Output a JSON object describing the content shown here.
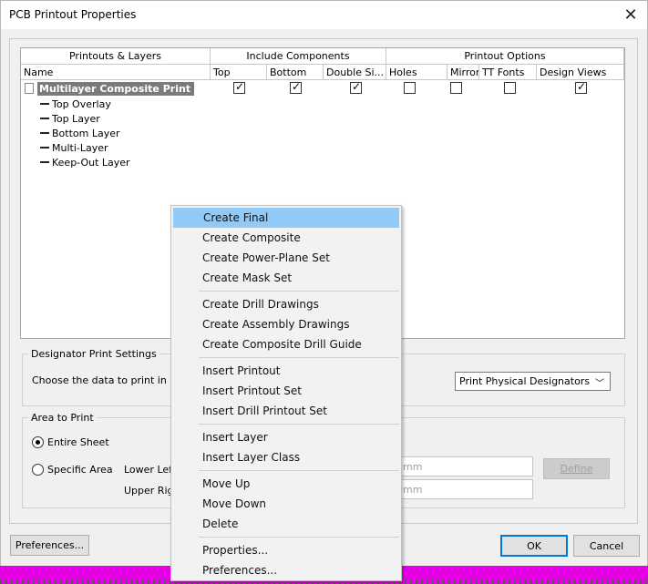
{
  "window": {
    "title": "PCB Printout Properties"
  },
  "grid": {
    "group_headers": [
      "Printouts & Layers",
      "Include Components",
      "Printout Options"
    ],
    "columns": [
      "Name",
      "Top",
      "Bottom",
      "Double Si...",
      "Holes",
      "Mirror",
      "TT Fonts",
      "Design Views"
    ],
    "printout": {
      "name": "Multilayer Composite Print",
      "checks": {
        "top": true,
        "bottom": true,
        "double_sided": true,
        "holes": false,
        "mirror": false,
        "tt_fonts": false,
        "design_views": true
      }
    },
    "layers": [
      "Top Overlay",
      "Top Layer",
      "Bottom Layer",
      "Multi-Layer",
      "Keep-Out Layer"
    ]
  },
  "designator": {
    "title": "Designator Print Settings",
    "label": "Choose the data to print in co",
    "selected": "Print Physical Designators"
  },
  "area": {
    "title": "Area to Print",
    "entire_sheet": "Entire Sheet",
    "specific_area": "Specific Area",
    "lower_left": "Lower Left",
    "upper_right": "Upper Rig",
    "lower_left_value": "0mm",
    "upper_right_value": "0mm",
    "define": "Define"
  },
  "buttons": {
    "preferences": "Preferences...",
    "ok": "OK",
    "cancel": "Cancel"
  },
  "context_menu": {
    "g1": [
      "Create Final",
      "Create Composite",
      "Create Power-Plane Set",
      "Create Mask Set"
    ],
    "g2": [
      "Create Drill Drawings",
      "Create Assembly Drawings",
      "Create Composite Drill Guide"
    ],
    "g3": [
      "Insert Printout",
      "Insert Printout Set",
      "Insert Drill Printout Set"
    ],
    "g4": [
      "Insert Layer",
      "Insert Layer Class"
    ],
    "g5": [
      "Move Up",
      "Move Down",
      "Delete"
    ],
    "g6": [
      "Properties...",
      "Preferences..."
    ]
  }
}
